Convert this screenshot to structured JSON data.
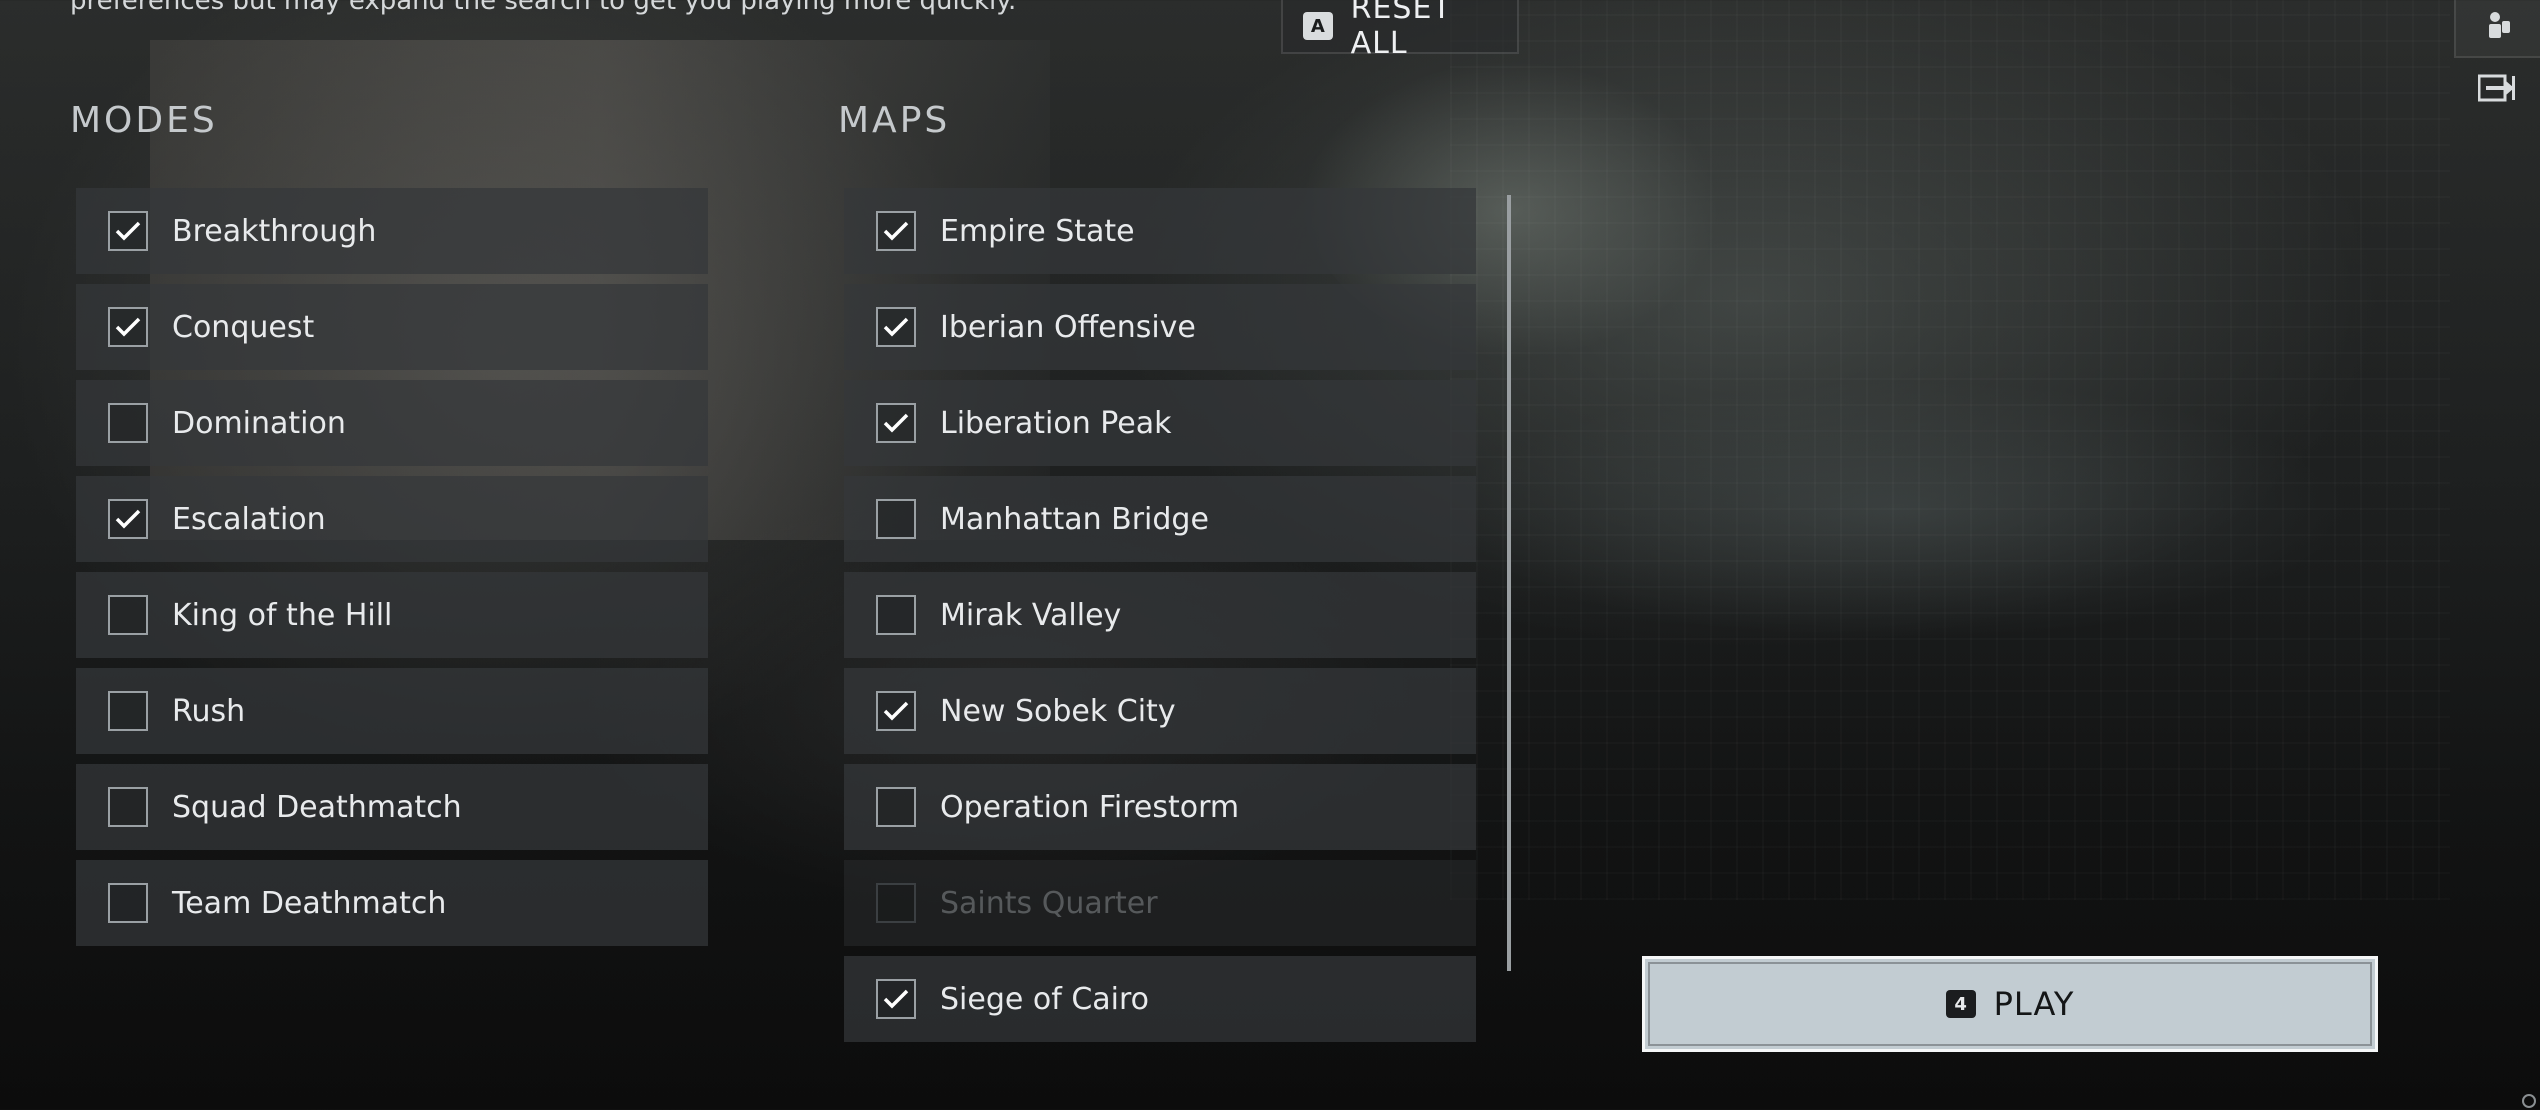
{
  "description": "preferences but may expand the search to get you playing more quickly.",
  "reset_button": {
    "key": "A",
    "label": "RESET ALL"
  },
  "modes": {
    "title": "MODES",
    "items": [
      {
        "label": "Breakthrough",
        "checked": true
      },
      {
        "label": "Conquest",
        "checked": true
      },
      {
        "label": "Domination",
        "checked": false
      },
      {
        "label": "Escalation",
        "checked": true
      },
      {
        "label": "King of the Hill",
        "checked": false
      },
      {
        "label": "Rush",
        "checked": false
      },
      {
        "label": "Squad Deathmatch",
        "checked": false
      },
      {
        "label": "Team Deathmatch",
        "checked": false
      }
    ]
  },
  "maps": {
    "title": "MAPS",
    "items": [
      {
        "label": "Empire State",
        "checked": true,
        "disabled": false
      },
      {
        "label": "Iberian Offensive",
        "checked": true,
        "disabled": false
      },
      {
        "label": "Liberation Peak",
        "checked": true,
        "disabled": false
      },
      {
        "label": "Manhattan Bridge",
        "checked": false,
        "disabled": false
      },
      {
        "label": "Mirak Valley",
        "checked": false,
        "disabled": false
      },
      {
        "label": "New Sobek City",
        "checked": true,
        "disabled": false
      },
      {
        "label": "Operation Firestorm",
        "checked": false,
        "disabled": false
      },
      {
        "label": "Saints Quarter",
        "checked": false,
        "disabled": true
      },
      {
        "label": "Siege of Cairo",
        "checked": true,
        "disabled": false
      }
    ]
  },
  "play_button": {
    "key": "4",
    "label": "PLAY"
  },
  "icons": {
    "top_right": "squad-icon",
    "exit": "exit-icon"
  }
}
